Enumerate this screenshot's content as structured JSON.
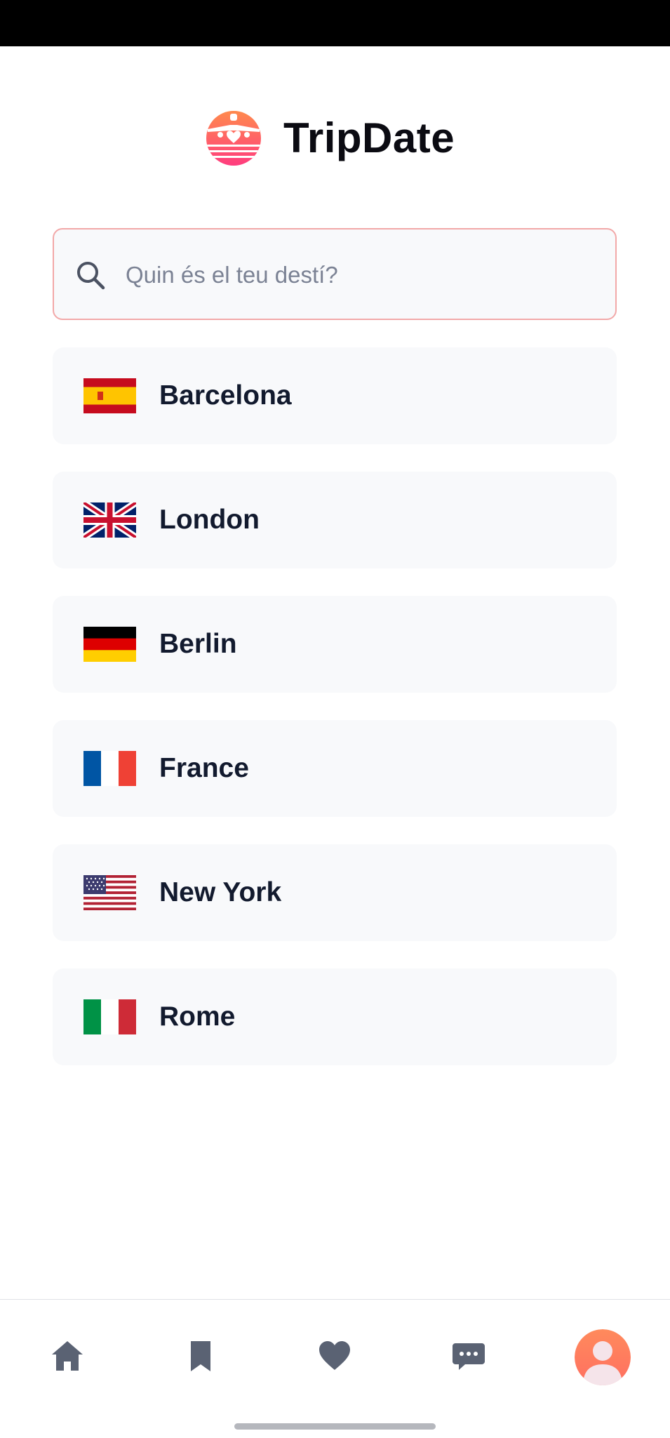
{
  "app": {
    "title": "TripDate",
    "brand_gradient": [
      "#ff7a59",
      "#ff3d7f"
    ]
  },
  "search": {
    "placeholder": "Quin és el teu destí?",
    "value": "",
    "border_color": "#f2a8a8"
  },
  "destinations": [
    {
      "name": "Barcelona",
      "flag": "spain-flag-icon"
    },
    {
      "name": "London",
      "flag": "uk-flag-icon"
    },
    {
      "name": "Berlin",
      "flag": "germany-flag-icon"
    },
    {
      "name": "France",
      "flag": "france-flag-icon"
    },
    {
      "name": "New York",
      "flag": "usa-flag-icon"
    },
    {
      "name": "Rome",
      "flag": "italy-flag-icon"
    }
  ],
  "bottom_nav": {
    "items": [
      "home-icon",
      "bookmark-icon",
      "heart-icon",
      "chat-icon",
      "profile-avatar"
    ],
    "icon_color": "#5a6273",
    "avatar_color": "#ff7a59"
  }
}
